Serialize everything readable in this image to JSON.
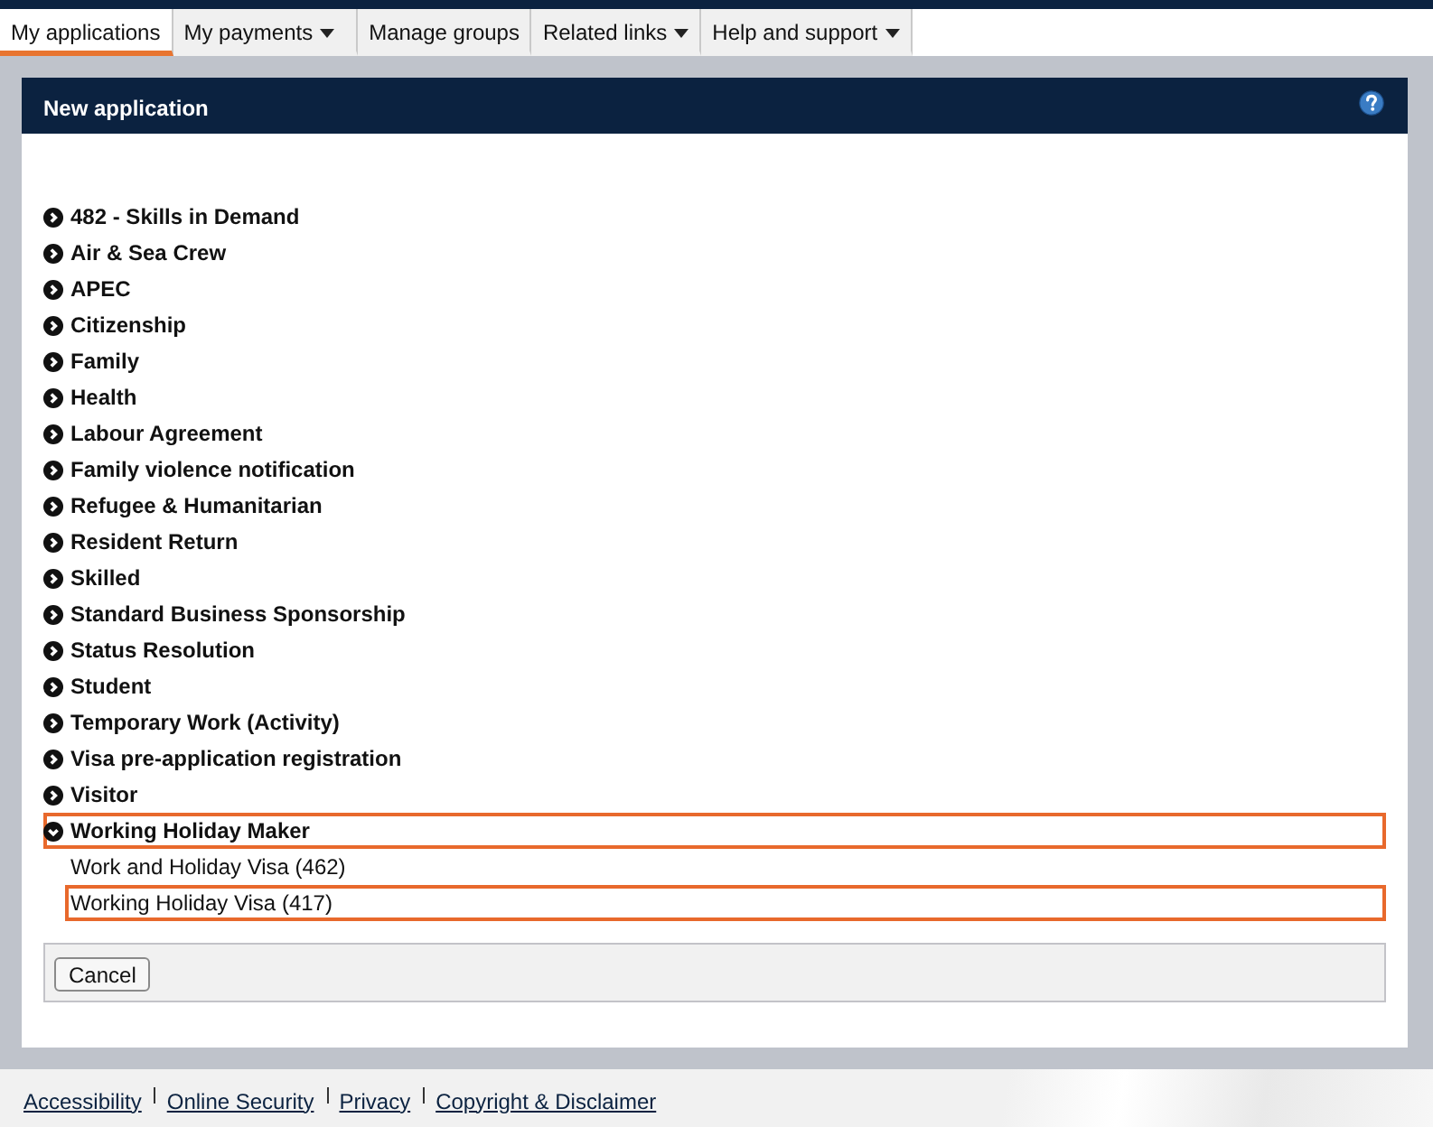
{
  "nav": {
    "tabs": [
      {
        "label": "My applications",
        "selected": true,
        "dropdown": false
      },
      {
        "label": "My payments",
        "selected": false,
        "dropdown": true
      },
      {
        "label": "Manage groups",
        "selected": false,
        "dropdown": false
      },
      {
        "label": "Related links",
        "selected": false,
        "dropdown": true
      },
      {
        "label": "Help and support",
        "selected": false,
        "dropdown": true
      }
    ]
  },
  "panel": {
    "title": "New application",
    "categories": [
      {
        "label": "482 - Skills in Demand",
        "expanded": false,
        "selected": false
      },
      {
        "label": "Air & Sea Crew",
        "expanded": false,
        "selected": false
      },
      {
        "label": "APEC",
        "expanded": false,
        "selected": false
      },
      {
        "label": "Citizenship",
        "expanded": false,
        "selected": false
      },
      {
        "label": "Family",
        "expanded": false,
        "selected": false
      },
      {
        "label": "Health",
        "expanded": false,
        "selected": false
      },
      {
        "label": "Labour Agreement",
        "expanded": false,
        "selected": false
      },
      {
        "label": "Family violence notification",
        "expanded": false,
        "selected": false
      },
      {
        "label": "Refugee & Humanitarian",
        "expanded": false,
        "selected": false
      },
      {
        "label": "Resident Return",
        "expanded": false,
        "selected": false
      },
      {
        "label": "Skilled",
        "expanded": false,
        "selected": false
      },
      {
        "label": "Standard Business Sponsorship",
        "expanded": false,
        "selected": false
      },
      {
        "label": "Status Resolution",
        "expanded": false,
        "selected": false
      },
      {
        "label": "Student",
        "expanded": false,
        "selected": false
      },
      {
        "label": "Temporary Work (Activity)",
        "expanded": false,
        "selected": false
      },
      {
        "label": "Visa pre-application registration",
        "expanded": false,
        "selected": false
      },
      {
        "label": "Visitor",
        "expanded": false,
        "selected": false
      },
      {
        "label": "Working Holiday Maker",
        "expanded": true,
        "selected": true,
        "children": [
          {
            "label": "Work and Holiday Visa (462)",
            "selected": false
          },
          {
            "label": "Working Holiday Visa (417)",
            "selected": true
          }
        ]
      }
    ],
    "buttons": [
      "Cancel"
    ]
  },
  "footer": {
    "links": [
      "Accessibility",
      "Online Security",
      "Privacy",
      "Copyright & Disclaimer"
    ]
  }
}
